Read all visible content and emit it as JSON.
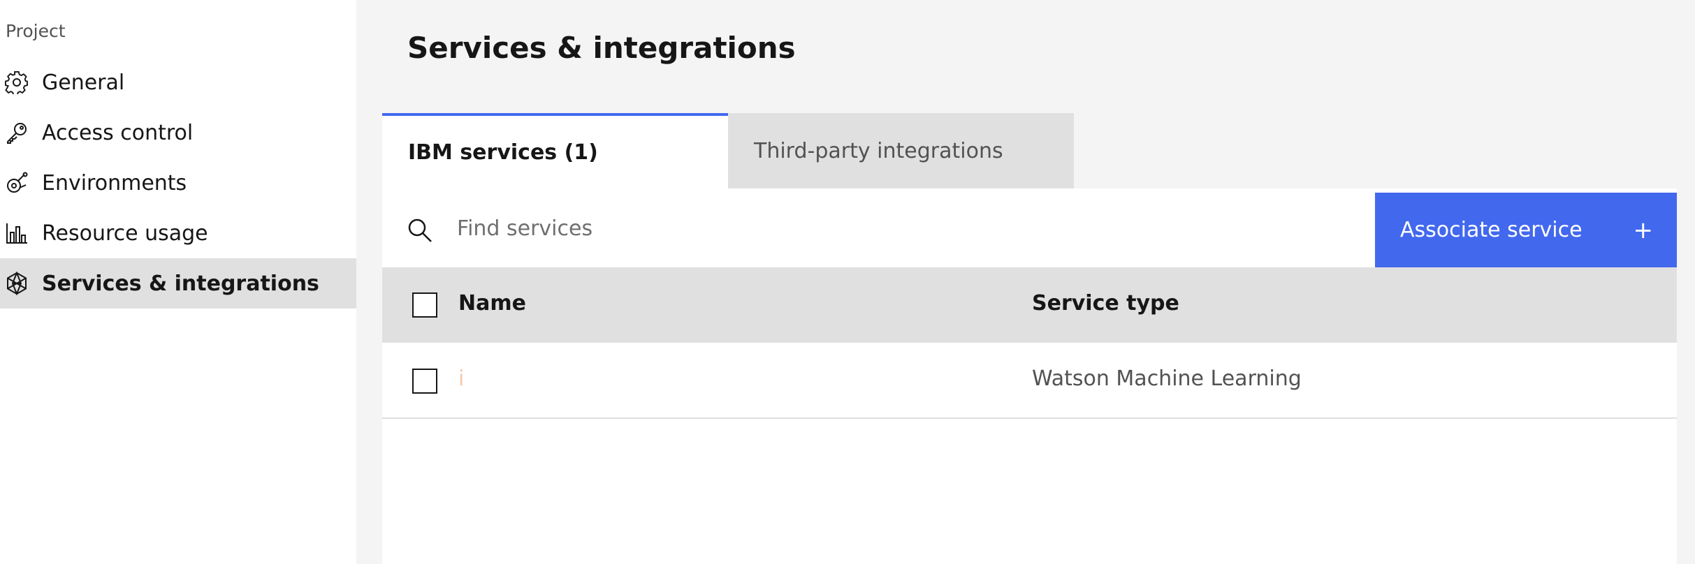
{
  "sidebar": {
    "heading": "Project",
    "items": [
      {
        "label": "General",
        "icon": "gear-icon"
      },
      {
        "label": "Access control",
        "icon": "key-icon"
      },
      {
        "label": "Environments",
        "icon": "environment-icon"
      },
      {
        "label": "Resource usage",
        "icon": "bar-chart-icon"
      },
      {
        "label": "Services & integrations",
        "icon": "integrations-icon",
        "active": true
      }
    ]
  },
  "main": {
    "title": "Services & integrations",
    "tabs": [
      {
        "label": "IBM services (1)",
        "active": true
      },
      {
        "label": "Third-party integrations",
        "active": false
      }
    ],
    "search": {
      "placeholder": "Find services",
      "value": ""
    },
    "associate_button": {
      "label": "Associate service",
      "icon": "plus-icon"
    },
    "table": {
      "columns": [
        "Name",
        "Service type"
      ],
      "rows": [
        {
          "name": "i",
          "service_type": "Watson Machine Learning"
        }
      ]
    }
  },
  "colors": {
    "accent": "#4268ee",
    "sidebar_active_bg": "#e0e0e0",
    "page_bg": "#f4f4f4",
    "link_text": "#f5c9a8"
  }
}
